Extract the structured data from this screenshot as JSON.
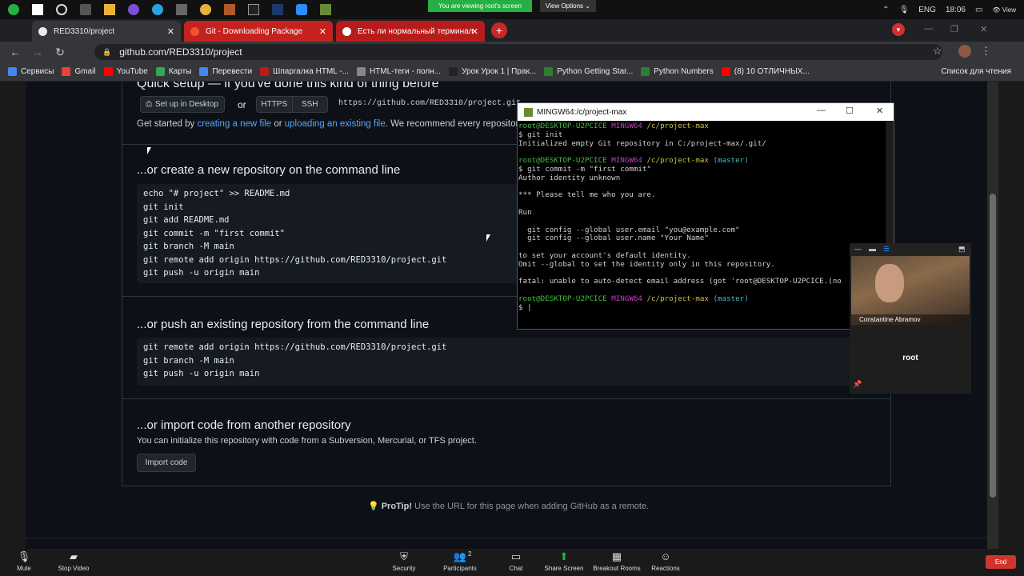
{
  "zoom": {
    "banner": "You are viewing root's screen",
    "view_options": "View Options ⌄",
    "video_name": "Constantine Abramov",
    "screen_user": "root",
    "toolbar": [
      {
        "icon": "microphone-icon",
        "glyph": "🎙",
        "label": "Mute"
      },
      {
        "icon": "video-camera-icon",
        "glyph": "▰",
        "label": "Stop Video"
      },
      {
        "icon": "shield-icon",
        "glyph": "⛨",
        "label": "Security"
      },
      {
        "icon": "participants-icon",
        "glyph": "👥",
        "label": "Participants",
        "count": "2"
      },
      {
        "icon": "chat-bubble-icon",
        "glyph": "▭",
        "label": "Chat"
      },
      {
        "icon": "share-screen-icon",
        "glyph": "⬆",
        "label": "Share Screen"
      },
      {
        "icon": "breakout-rooms-icon",
        "glyph": "▦",
        "label": "Breakout Rooms"
      },
      {
        "icon": "reactions-icon",
        "glyph": "☺",
        "label": "Reactions"
      }
    ],
    "end_label": "End"
  },
  "tray": {
    "language": "ENG",
    "time": "18:06"
  },
  "browser": {
    "tabs": [
      {
        "title": "RED3310/project"
      },
      {
        "title": "Git - Downloading Package"
      },
      {
        "title": "Есть ли нормальный терминал"
      }
    ],
    "url": "github.com/RED3310/project",
    "bookmarks": [
      {
        "label": "Сервисы",
        "color": "#4285f4"
      },
      {
        "label": "Gmail",
        "color": "#ea4335"
      },
      {
        "label": "YouTube",
        "color": "#ff0000"
      },
      {
        "label": "Карты",
        "color": "#34a853"
      },
      {
        "label": "Перевести",
        "color": "#4285f4"
      },
      {
        "label": "Шпаргалка HTML -...",
        "color": "#b71c1c"
      },
      {
        "label": "HTML-теги - полн...",
        "color": "#888888"
      },
      {
        "label": "Урок Урок 1 | Прак...",
        "color": "#222222"
      },
      {
        "label": "Python Getting Star...",
        "color": "#2e7d32"
      },
      {
        "label": "Python Numbers",
        "color": "#2e7d32"
      },
      {
        "label": "(8) 10 ОТЛИЧНЫХ...",
        "color": "#ff0000"
      }
    ],
    "reading_list": "Список для чтения"
  },
  "github": {
    "quick_setup": "Quick setup — if you've done this kind of thing before",
    "setup_desktop": "Set up in Desktop",
    "or": "or",
    "https": "HTTPS",
    "ssh": "SSH",
    "clone_url": "https://github.com/RED3310/project.git",
    "get_started_prefix": "Get started by ",
    "get_started_link1": "creating a new file",
    "get_started_mid": " or ",
    "get_started_link2": "uploading an existing file",
    "get_started_suffix": ". We recommend every repository in",
    "new_repo_title": "...or create a new repository on the command line",
    "new_repo_code": [
      "echo \"# project\" >> README.md",
      "git init",
      "git add README.md",
      "git commit -m \"first commit\"",
      "git branch -M main",
      "git remote add origin https://github.com/RED3310/project.git",
      "git push -u origin main"
    ],
    "push_title": "...or push an existing repository from the command line",
    "push_code": [
      "git remote add origin https://github.com/RED3310/project.git",
      "git branch -M main",
      "git push -u origin main"
    ],
    "import_title": "...or import code from another repository",
    "import_sub": "You can initialize this repository with code from a Subversion, Mercurial, or TFS project.",
    "import_button": "Import code",
    "protip_label": "ProTip!",
    "protip_text": " Use the URL for this page when adding GitHub as a remote."
  },
  "terminal": {
    "title": "MINGW64:/c/project-max",
    "prompt_user": "root@DESKTOP-U2PCICE",
    "prompt_env": "MINGW64",
    "prompt_path": "/c/project-max",
    "prompt_branch": "(master)",
    "cmd1": "$ git init",
    "out1": "Initialized empty Git repository in C:/project-max/.git/",
    "cmd2": "$ git commit -m \"first commit\"",
    "out2": [
      "Author identity unknown",
      "",
      "*** Please tell me who you are.",
      "",
      "Run",
      "",
      "  git config --global user.email \"you@example.com\"",
      "  git config --global user.name \"Your Name\"",
      "",
      "to set your account's default identity.",
      "Omit --global to set the identity only in this repository.",
      "",
      "fatal: unable to auto-detect email address (got 'root@DESKTOP-U2PCICE.(no"
    ],
    "cursor_line": "$ |"
  }
}
